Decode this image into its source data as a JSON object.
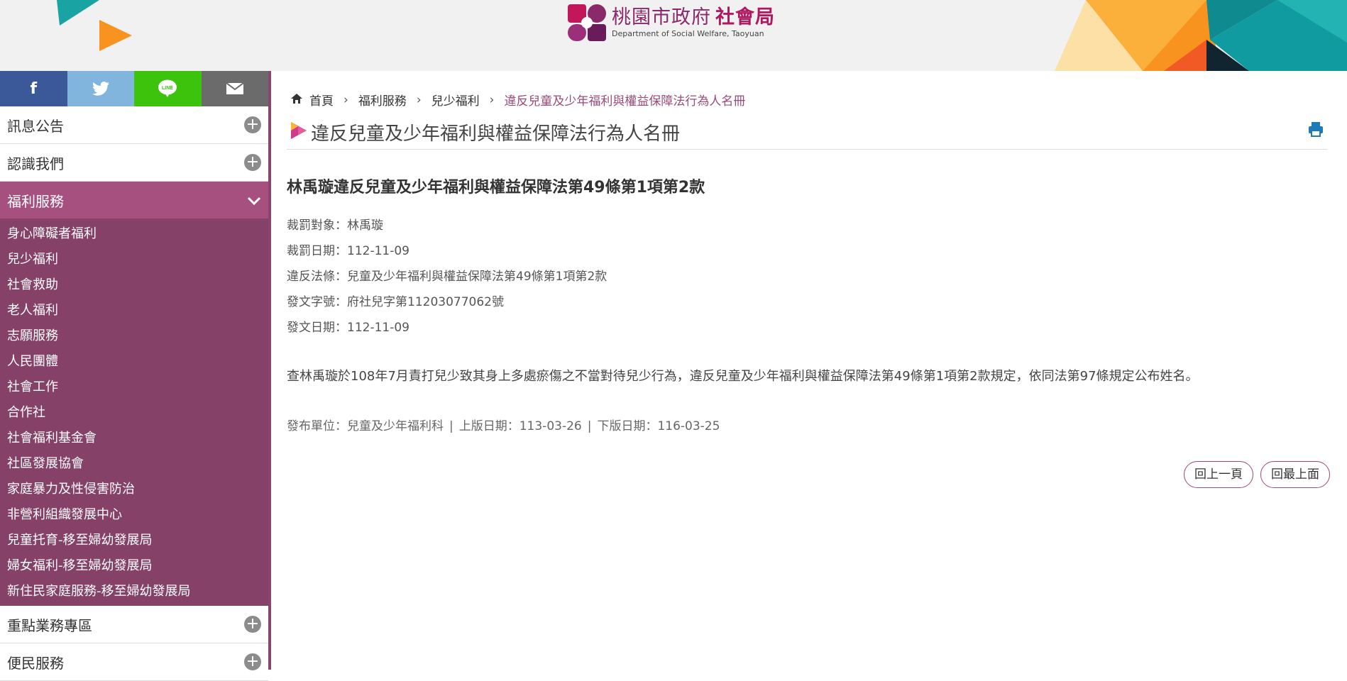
{
  "header": {
    "title_cn": "桃園市政府",
    "title_cn_bold": "社會局",
    "title_en": "Department of Social Welfare, Taoyuan"
  },
  "share": [
    {
      "name": "facebook-icon",
      "glyph": "f",
      "color": "#3b5998"
    },
    {
      "name": "twitter-icon",
      "glyph": "🐦",
      "color": "#81b5dd"
    },
    {
      "name": "line-icon",
      "glyph": "LINE",
      "color": "#3cc30b"
    },
    {
      "name": "mail-icon",
      "glyph": "✉",
      "color": "#6b6b6b"
    }
  ],
  "sidebar": {
    "sections": [
      {
        "label": "訊息公告",
        "expanded": false
      },
      {
        "label": "認識我們",
        "expanded": false
      },
      {
        "label": "福利服務",
        "expanded": true
      },
      {
        "label": "重點業務專區",
        "expanded": false
      },
      {
        "label": "便民服務",
        "expanded": false
      }
    ],
    "sub_items": [
      "身心障礙者福利",
      "兒少福利",
      "社會救助",
      "老人福利",
      "志願服務",
      "人民團體",
      "社會工作",
      "合作社",
      "社會福利基金會",
      "社區發展協會",
      "家庭暴力及性侵害防治",
      "非營利組織發展中心",
      "兒童托育-移至婦幼發展局",
      "婦女福利-移至婦幼發展局",
      "新住民家庭服務-移至婦幼發展局"
    ]
  },
  "breadcrumb": {
    "home": "首頁",
    "level1": "福利服務",
    "level2": "兒少福利",
    "current": "違反兒童及少年福利與權益保障法行為人名冊"
  },
  "page_title": "違反兒童及少年福利與權益保障法行為人名冊",
  "article": {
    "title": "林禹璇違反兒童及少年福利與權益保障法第49條第1項第2款",
    "meta": [
      "裁罰對象：林禹璇",
      "裁罰日期：112-11-09",
      "違反法條：兒童及少年福利與權益保障法第49條第1項第2款",
      "發文字號：府社兒字第11203077062號",
      "發文日期：112-11-09"
    ],
    "body": "查林禹璇於108年7月責打兒少致其身上多處瘀傷之不當對待兒少行為，違反兒童及少年福利與權益保障法第49條第1項第2款規定，依同法第97條規定公布姓名。",
    "publisher": "發布單位：兒童及少年福利科",
    "online_date": "上版日期：113-03-26",
    "offline_date": "下版日期：116-03-25",
    "separator": "|"
  },
  "buttons": {
    "back": "回上一頁",
    "top": "回最上面"
  },
  "colors": {
    "accent": "#a5507e",
    "submenu_bg": "#864168",
    "link_current": "#9a4a78"
  }
}
